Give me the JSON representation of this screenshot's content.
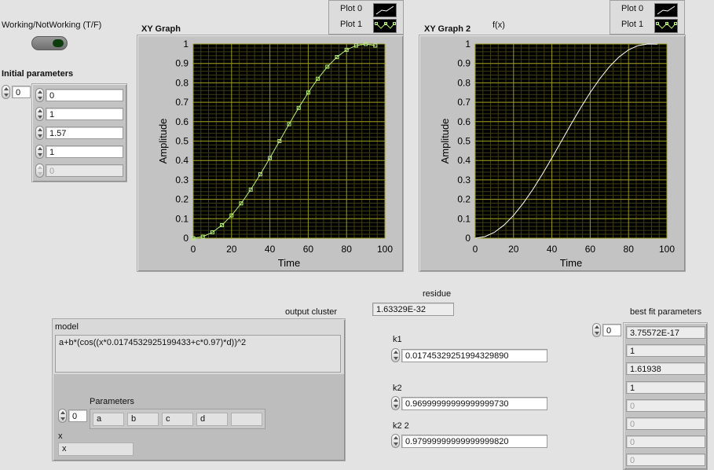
{
  "toggle": {
    "label": "Working/NotWorking (T/F)",
    "state": false
  },
  "initial_parameters": {
    "label": "Initial parameters",
    "index": "0",
    "values": [
      "0",
      "1",
      "1.57",
      "1",
      "0"
    ],
    "disabled_from": 4
  },
  "graph1": {
    "title": "XY Graph",
    "legend": [
      "Plot 0",
      "Plot 1"
    ],
    "xlabel": "Time",
    "ylabel": "Amplitude"
  },
  "graph2": {
    "title": "XY Graph 2",
    "subtitle": "f(x)",
    "legend": [
      "Plot 0",
      "Plot 1"
    ],
    "xlabel": "Time",
    "ylabel": "Amplitude"
  },
  "residue": {
    "label": "residue",
    "value": "1.63329E-32"
  },
  "output_cluster": {
    "label": "output cluster",
    "model_label": "model",
    "model": "a+b*(cos((x*0.0174532925199433+c*0.97)*d))^2",
    "params_label": "Parameters",
    "params_index": "0",
    "params": [
      "a",
      "b",
      "c",
      "d",
      ""
    ],
    "x_label": "x",
    "x_value": "x"
  },
  "k1": {
    "label": "k1",
    "value": "0.01745329251994329890"
  },
  "k2": {
    "label": "k2",
    "value": "0.96999999999999999730"
  },
  "k22": {
    "label": "k2 2",
    "value": "0.97999999999999999820"
  },
  "best_fit": {
    "label": "best fit parameters",
    "index": "0",
    "values": [
      "3.75572E-17",
      "1",
      "1.61938",
      "1",
      "0",
      "0",
      "0",
      "0"
    ],
    "disabled_from": 4
  },
  "colors": {
    "plot_bg": "#000000",
    "grid_major": "#9a9a1e",
    "grid_minor": "#3d3d12",
    "plot0": "#ffffff",
    "plot1": "#b9f07a",
    "panel": "#c3c3c3"
  },
  "chart_data": [
    {
      "type": "line",
      "title": "XY Graph",
      "xlabel": "Time",
      "ylabel": "Amplitude",
      "xlim": [
        0,
        100
      ],
      "ylim": [
        0,
        1
      ],
      "xticks": [
        0,
        20,
        40,
        60,
        80,
        100
      ],
      "yticks": [
        0,
        0.1,
        0.2,
        0.3,
        0.4,
        0.5,
        0.6,
        0.7,
        0.8,
        0.9,
        1
      ],
      "grid": true,
      "legend": "top-right",
      "series": [
        {
          "name": "Plot 1",
          "x": [
            0,
            5,
            10,
            15,
            20,
            25,
            30,
            35,
            40,
            45,
            50,
            55,
            60,
            65,
            70,
            75,
            80,
            85,
            90,
            95
          ],
          "y": [
            0,
            0.0076,
            0.03,
            0.067,
            0.117,
            0.179,
            0.25,
            0.329,
            0.413,
            0.5,
            0.587,
            0.671,
            0.75,
            0.821,
            0.883,
            0.933,
            0.97,
            0.992,
            1,
            0.992
          ]
        }
      ]
    },
    {
      "type": "line",
      "title": "XY Graph 2",
      "subtitle": "f(x)",
      "xlabel": "Time",
      "ylabel": "Amplitude",
      "xlim": [
        0,
        100
      ],
      "ylim": [
        0,
        1
      ],
      "xticks": [
        0,
        20,
        40,
        60,
        80,
        100
      ],
      "yticks": [
        0,
        0.1,
        0.2,
        0.3,
        0.4,
        0.5,
        0.6,
        0.7,
        0.8,
        0.9,
        1
      ],
      "grid": true,
      "legend": "top-right",
      "series": [
        {
          "name": "Plot 0",
          "x": [
            0,
            5,
            10,
            15,
            20,
            25,
            30,
            35,
            40,
            45,
            50,
            55,
            60,
            65,
            70,
            75,
            80,
            85,
            90,
            95
          ],
          "y": [
            0,
            0.0076,
            0.03,
            0.067,
            0.117,
            0.179,
            0.25,
            0.329,
            0.413,
            0.5,
            0.587,
            0.671,
            0.75,
            0.821,
            0.883,
            0.933,
            0.97,
            0.992,
            1,
            0.999
          ]
        }
      ]
    }
  ]
}
